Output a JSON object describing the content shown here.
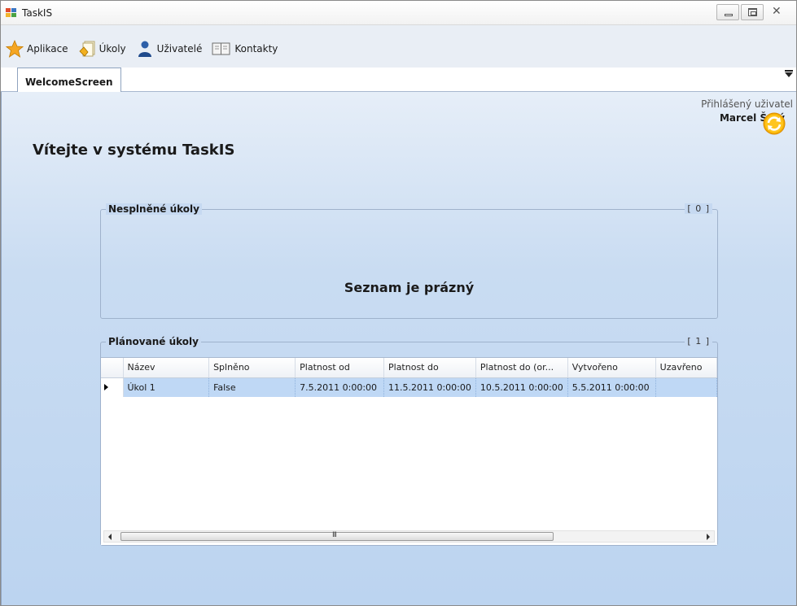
{
  "window": {
    "title": "TaskIS"
  },
  "menu": [
    {
      "label": "Aplikace",
      "icon": "star-icon"
    },
    {
      "label": "Úkoly",
      "icon": "tasks-icon"
    },
    {
      "label": "Uživatelé",
      "icon": "user-icon"
    },
    {
      "label": "Kontakty",
      "icon": "contacts-icon"
    }
  ],
  "tabs": [
    {
      "label": "WelcomeScreen"
    }
  ],
  "user": {
    "label": "Přihlášený uživatel",
    "name": "Marcel Šerý"
  },
  "welcome": "Vítejte v systému TaskIS",
  "unfinished": {
    "title": "Nesplněné úkoly",
    "count": "[ 0 ]",
    "empty": "Seznam je prázný"
  },
  "planned": {
    "title": "Plánované úkoly",
    "count": "[ 1 ]",
    "columns": [
      "Název",
      "Splněno",
      "Platnost od",
      "Platnost do",
      "Platnost do (or...",
      "Vytvořeno",
      "Uzavřeno"
    ],
    "rows": [
      [
        "Úkol 1",
        "False",
        "7.5.2011 0:00:00",
        "11.5.2011 0:00:00",
        "10.5.2011 0:00:00",
        "5.5.2011 0:00:00",
        ""
      ]
    ],
    "scroll_grip": "III"
  },
  "colors": {
    "accent": "#bfd8f5",
    "background": "#c9dcf2"
  }
}
